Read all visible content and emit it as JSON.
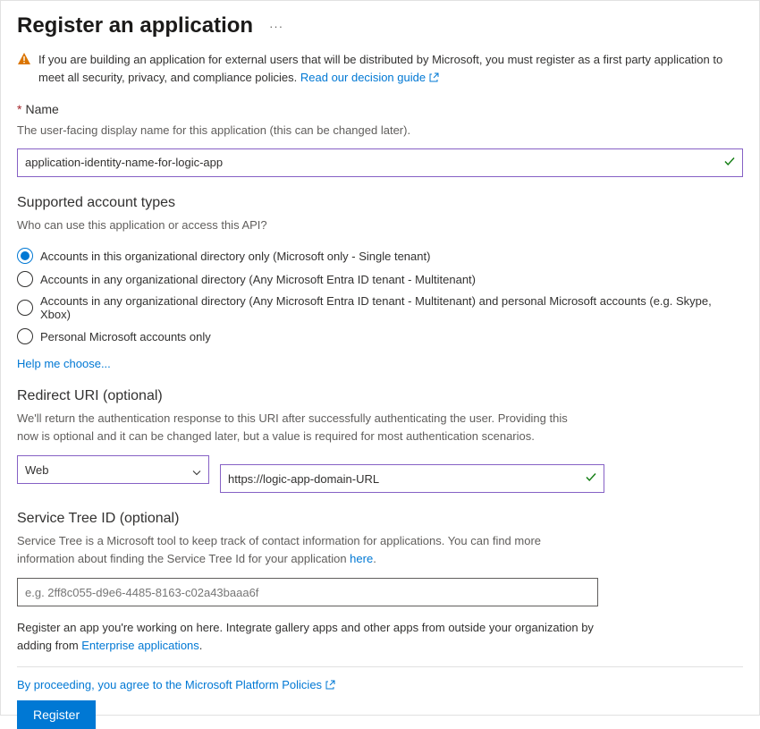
{
  "title": "Register an application",
  "warning": {
    "text": "If you are building an application for external users that will be distributed by Microsoft, you must register as a first party application to meet all security, privacy, and compliance policies. ",
    "link": "Read our decision guide"
  },
  "nameField": {
    "label": "Name",
    "helper": "The user-facing display name for this application (this can be changed later).",
    "value": "application-identity-name-for-logic-app"
  },
  "accountTypes": {
    "heading": "Supported account types",
    "question": "Who can use this application or access this API?",
    "options": [
      "Accounts in this organizational directory only (Microsoft only - Single tenant)",
      "Accounts in any organizational directory (Any Microsoft Entra ID tenant - Multitenant)",
      "Accounts in any organizational directory (Any Microsoft Entra ID tenant - Multitenant) and personal Microsoft accounts (e.g. Skype, Xbox)",
      "Personal Microsoft accounts only"
    ],
    "helpLink": "Help me choose..."
  },
  "redirect": {
    "heading": "Redirect URI (optional)",
    "helper": "We'll return the authentication response to this URI after successfully authenticating the user. Providing this now is optional and it can be changed later, but a value is required for most authentication scenarios.",
    "platform": "Web",
    "uri": "https://logic-app-domain-URL"
  },
  "serviceTree": {
    "heading": "Service Tree ID (optional)",
    "helperPrefix": "Service Tree is a Microsoft tool to keep track of contact information for applications. You can find more information about finding the Service Tree Id for your application ",
    "helperLink": "here",
    "placeholder": "e.g. 2ff8c055-d9e6-4485-8163-c02a43baaa6f"
  },
  "note": {
    "text": "Register an app you're working on here. Integrate gallery apps and other apps from outside your organization by adding from ",
    "link": "Enterprise applications"
  },
  "footer": {
    "agree": "By proceeding, you agree to the Microsoft Platform Policies",
    "button": "Register"
  }
}
